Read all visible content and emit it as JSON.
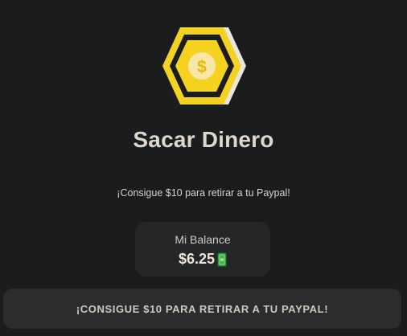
{
  "header": {
    "logo_icon": "hexagon-dollar-coin-icon",
    "logo_symbol": "$",
    "title": "Sacar Dinero"
  },
  "main": {
    "subtitle": "¡Consigue $10 para retirar a tu Paypal!",
    "balance": {
      "label": "Mi Balance",
      "value": "$6.25",
      "icon": "money-bill-icon"
    },
    "withdraw_button": {
      "label": "¡CONSIGUE $10 PARA RETIRAR A TU PAYPAL!"
    }
  },
  "colors": {
    "background": "#1b1c1e",
    "accent_yellow": "#f5d21f",
    "card": "#252628",
    "button": "#2a2c2e"
  }
}
